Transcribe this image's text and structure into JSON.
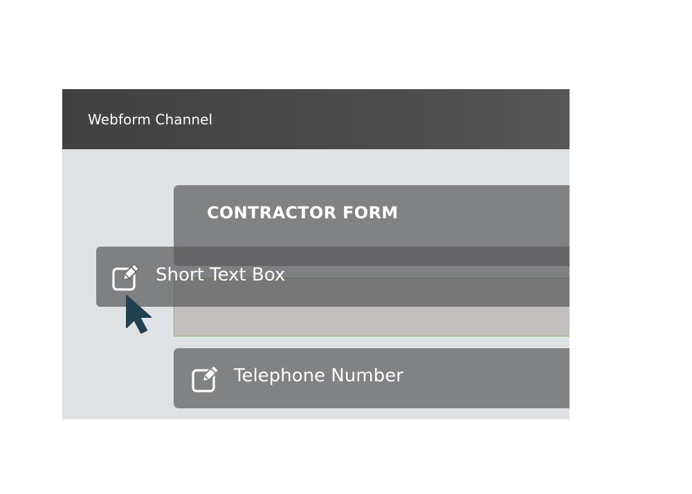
{
  "window": {
    "title": "Webform Channel"
  },
  "form": {
    "title": "CONTRACTOR FORM"
  },
  "dragged_field": {
    "label": "Short Text Box",
    "icon": "edit-icon"
  },
  "fields": [
    {
      "label": "Telephone Number",
      "icon": "edit-icon"
    }
  ],
  "colors": {
    "titlebar": "#454545",
    "canvas": "#dfe2e5",
    "card": "#818284",
    "drop_zone": "#c3c0bf",
    "drop_zone_border": "#7fb26a",
    "cursor": "#22404f"
  }
}
